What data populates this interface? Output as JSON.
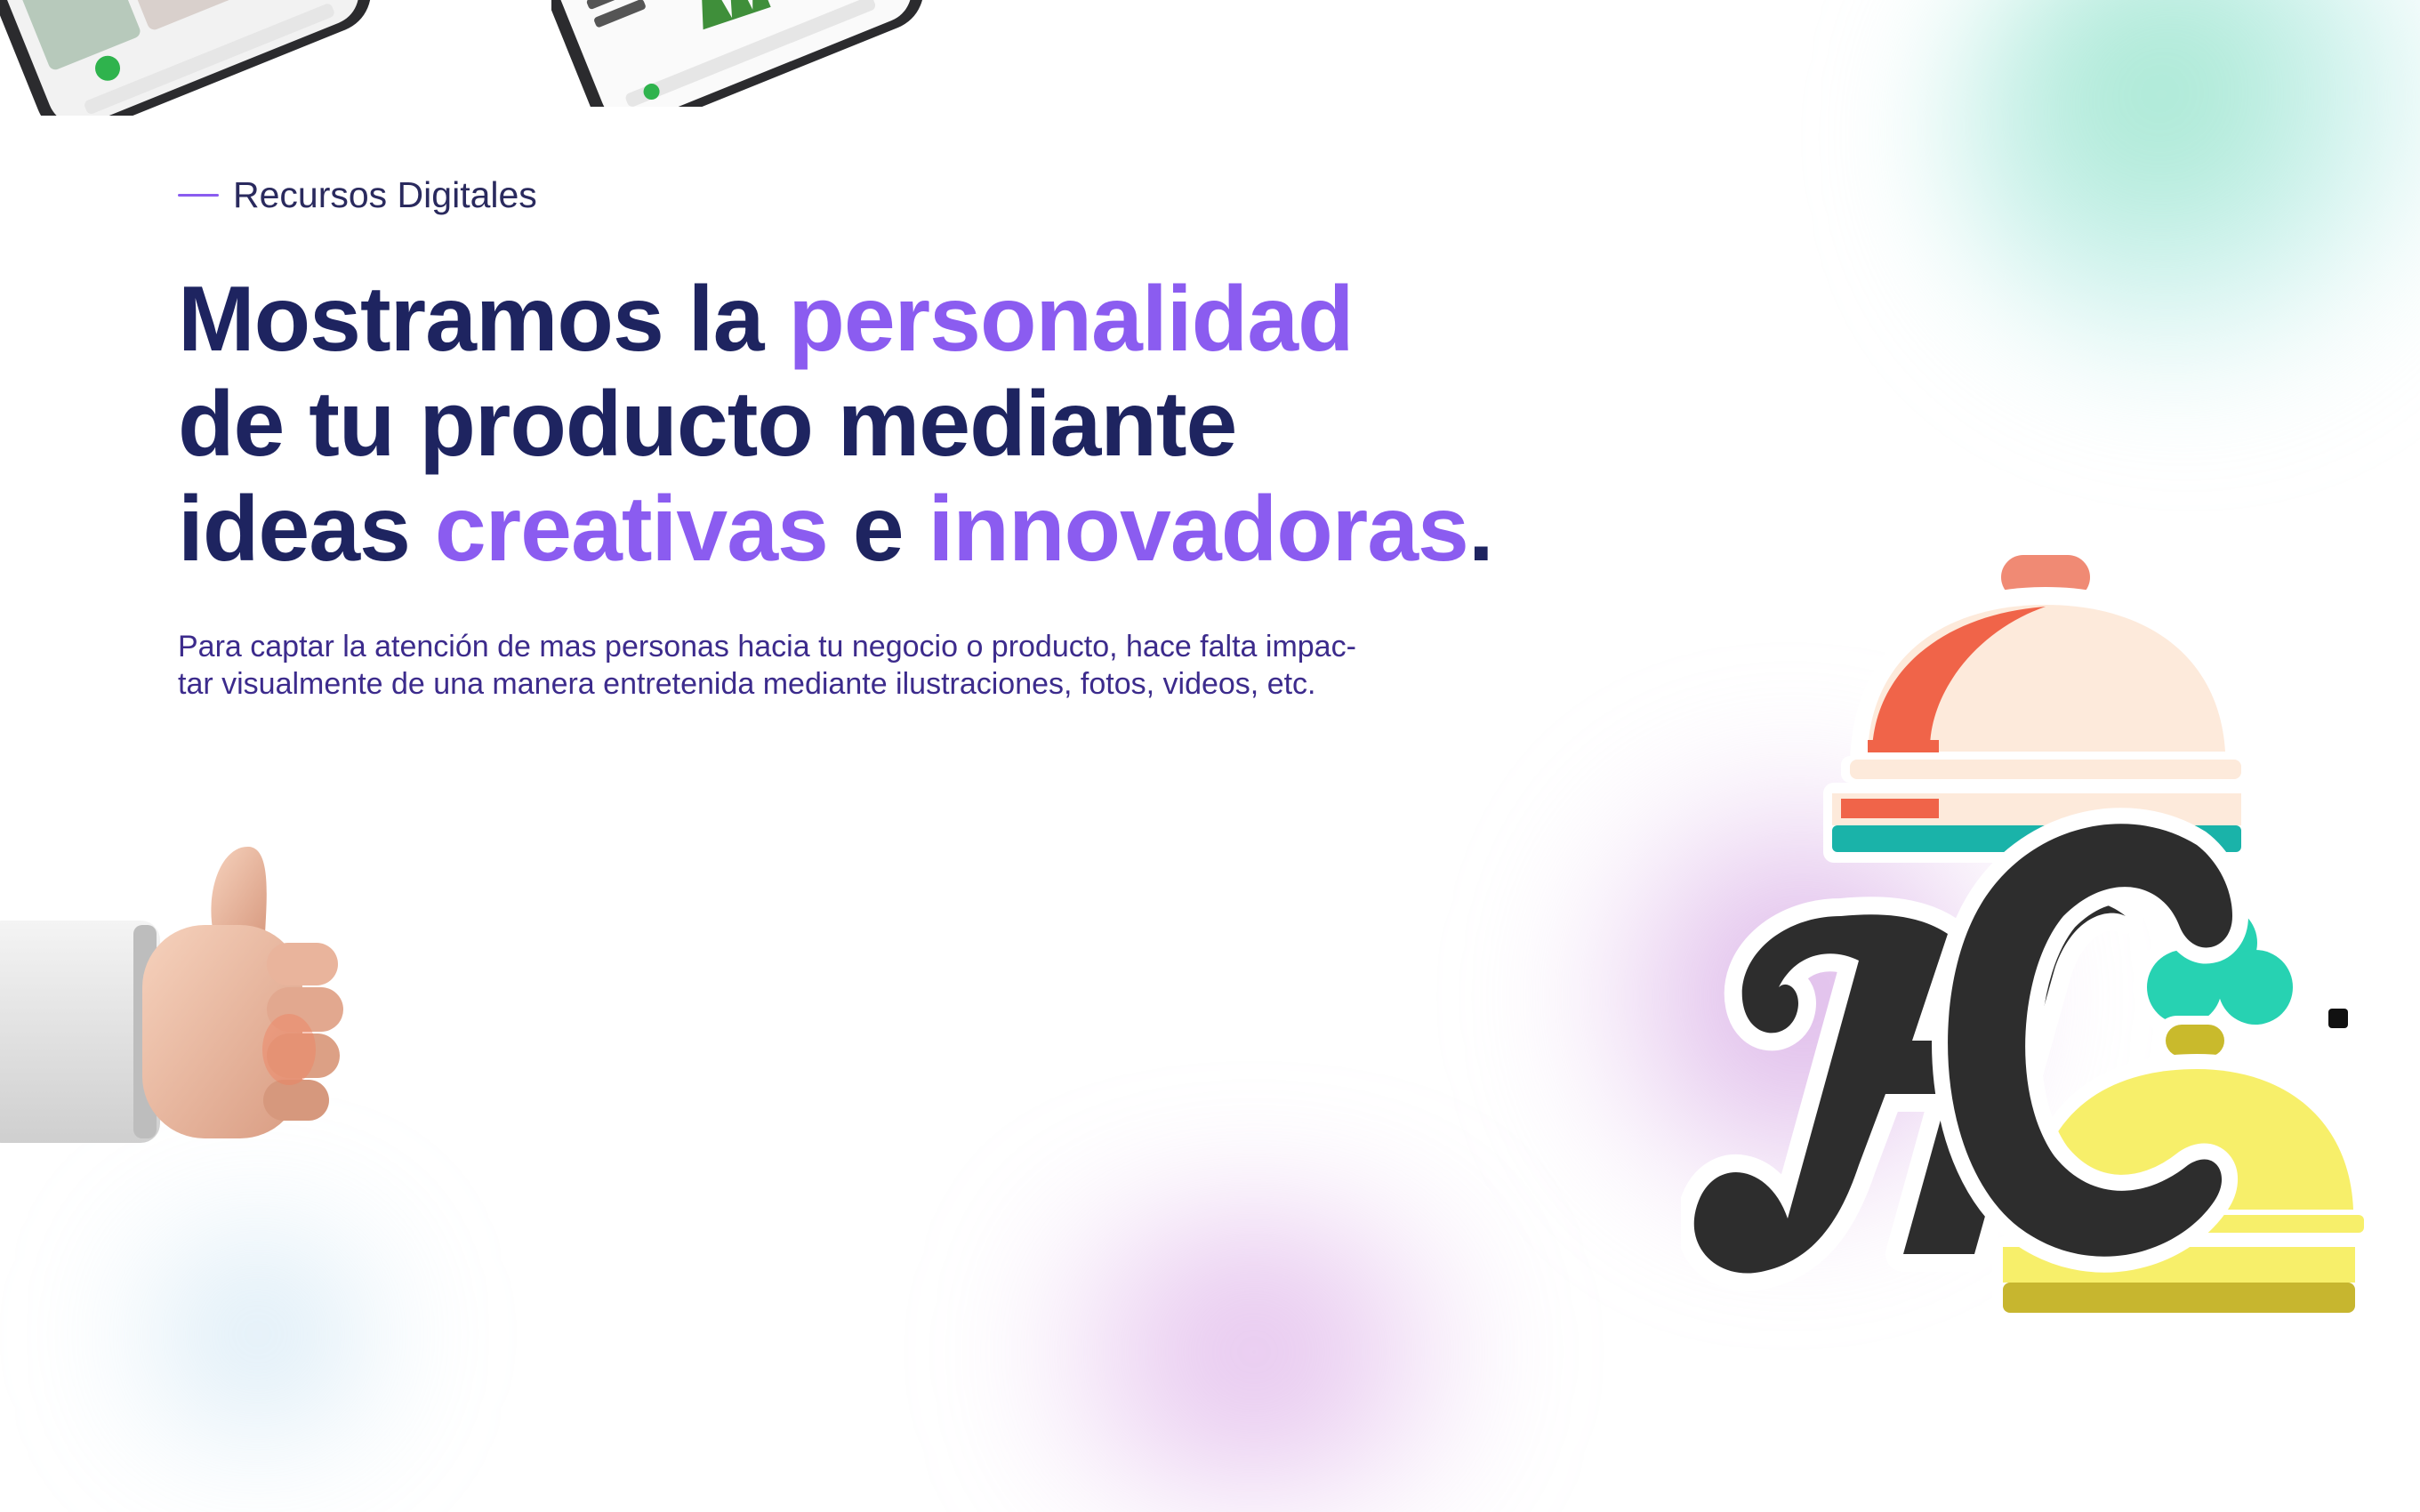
{
  "hero": {
    "eyebrow": "Recursos Digitales",
    "headline": {
      "l1a": "Mostramos la ",
      "l1b": "personalidad",
      "l2": "de tu producto mediante",
      "l3a": "ideas ",
      "l3b": "creativas",
      "l3c": " e ",
      "l3d": "innovadoras",
      "l3e": "."
    },
    "description_1": "Para captar la atención de mas personas hacia tu negocio o producto, hace falta impac-",
    "description_2": "tar visualmente de una manera entretenida mediante ilustraciones, fotos, videos, etc."
  },
  "colors": {
    "navy": "#1e2460",
    "accent_purple": "#8b5cf0",
    "body_text": "#3c2b8c"
  },
  "icons": [
    "smartphone-mockup",
    "thumbs-up-icon",
    "logo-hc",
    "cloche-icon",
    "shamrock-icon"
  ]
}
